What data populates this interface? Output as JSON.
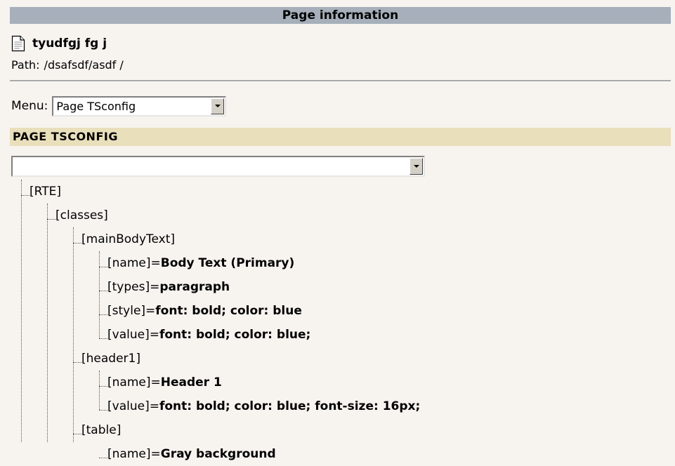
{
  "header": {
    "title": "Page information"
  },
  "page": {
    "icon": "document-icon",
    "title": "tyudfgj fg j",
    "path_label": "Path:",
    "path_value": "/dsafsdf/asdf /"
  },
  "menu": {
    "label": "Menu:",
    "selected": "Page TSconfig"
  },
  "section": {
    "title": "PAGE TSCONFIG"
  },
  "tsconfig_select": {
    "selected": ""
  },
  "tree": [
    {
      "key": "[RTE]",
      "value": "",
      "level": 0
    },
    {
      "key": "[classes]",
      "value": "",
      "level": 1
    },
    {
      "key": "[mainBodyText]",
      "value": "",
      "level": 2
    },
    {
      "key": "[name]=",
      "value": "Body Text (Primary)",
      "level": 3
    },
    {
      "key": "[types]=",
      "value": "paragraph",
      "level": 3
    },
    {
      "key": "[style]=",
      "value": "font: bold; color: blue",
      "level": 3
    },
    {
      "key": "[value]=",
      "value": "font: bold; color: blue;",
      "level": 3
    },
    {
      "key": "[header1]",
      "value": "",
      "level": 2
    },
    {
      "key": "[name]=",
      "value": "Header 1",
      "level": 3
    },
    {
      "key": "[value]=",
      "value": "font: bold; color: blue; font-size: 16px;",
      "level": 3
    },
    {
      "key": "[table]",
      "value": "",
      "level": 2
    },
    {
      "key": "[name]=",
      "value": "Gray background",
      "level": 3
    }
  ]
}
